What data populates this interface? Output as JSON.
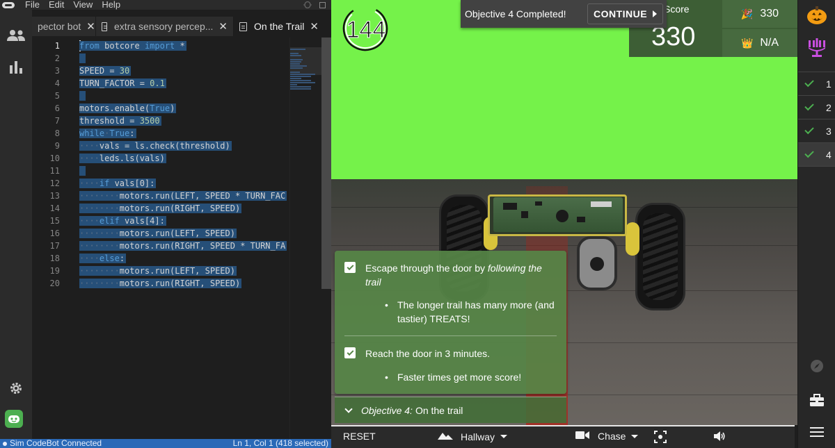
{
  "menu": {
    "items": [
      "File",
      "Edit",
      "View",
      "Help"
    ]
  },
  "tabs": [
    {
      "label": "pector bot",
      "active": false
    },
    {
      "label": "extra sensory percep...",
      "active": false
    },
    {
      "label": "On the Trail",
      "active": true
    }
  ],
  "editor": {
    "lines": [
      {
        "n": "1"
      },
      {
        "n": "2"
      },
      {
        "n": "3"
      },
      {
        "n": "4"
      },
      {
        "n": "5"
      },
      {
        "n": "6"
      },
      {
        "n": "7"
      },
      {
        "n": "8"
      },
      {
        "n": "9"
      },
      {
        "n": "10"
      },
      {
        "n": "11"
      },
      {
        "n": "12"
      },
      {
        "n": "13"
      },
      {
        "n": "14"
      },
      {
        "n": "15"
      },
      {
        "n": "16"
      },
      {
        "n": "17"
      },
      {
        "n": "18"
      },
      {
        "n": "19"
      },
      {
        "n": "20"
      }
    ],
    "code": {
      "l1_kw1": "from",
      "l1_mod": " botcore ",
      "l1_kw2": "import",
      "l1_rest": " *",
      "l3": "SPEED = ",
      "l3_num": "30",
      "l4": "TURN_FACTOR = ",
      "l4_num": "0.1",
      "l6": "motors.enable(",
      "l6_kw": "True",
      "l6_end": ")",
      "l7": "threshold = ",
      "l7_num": "3500",
      "l8_kw": "while",
      "l8_sp": "·",
      "l8_kw2": "True",
      "l8_end": ":",
      "l9": "vals = ls.check(threshold)",
      "l10": "leds.ls(vals)",
      "l12_kw": "if",
      "l12": " vals[0]:",
      "l13": "motors.run(LEFT, SPEED * TURN_FAC",
      "l14": "motors.run(RIGHT, SPEED)",
      "l15_kw": "elif",
      "l15": " vals[4]:",
      "l16": "motors.run(LEFT, SPEED)",
      "l17": "motors.run(RIGHT, SPEED * TURN_FA",
      "l18_kw": "else",
      "l18": ":",
      "l19": "motors.run(LEFT, SPEED)",
      "l20": "motors.run(RIGHT, SPEED)",
      "indent1": "····",
      "indent2": "········"
    }
  },
  "status": {
    "left": "Sim CodeBot Connected",
    "right": "Ln 1, Col 1 (418 selected)"
  },
  "sim": {
    "timer": "144",
    "banner_text": "Objective 4 Completed!",
    "continue_label": "CONTINUE",
    "score_label": "Score",
    "score_value": "330",
    "best_score": "330",
    "best_time": "N/A",
    "objectives": {
      "item1_a": "Escape through the door by ",
      "item1_em": "following the trail",
      "item1_bullet": "The longer trail has many more (and tastier) TREATS!",
      "item2": "Reach the door in 3 minutes.",
      "item2_bullet": "Faster times get more score!",
      "bullet_char": "•",
      "footer_em": "Objective 4:",
      "footer": " On the trail"
    },
    "bottombar": {
      "reset": "RESET",
      "environment": "Hallway",
      "camera": "Chase"
    }
  },
  "rail": {
    "objectives": [
      "1",
      "2",
      "3",
      "4"
    ]
  },
  "colors": {
    "accent_green": "#4caf50",
    "sky_green": "#75f24a",
    "status_blue": "#2a69b7",
    "selection": "#264f78"
  }
}
